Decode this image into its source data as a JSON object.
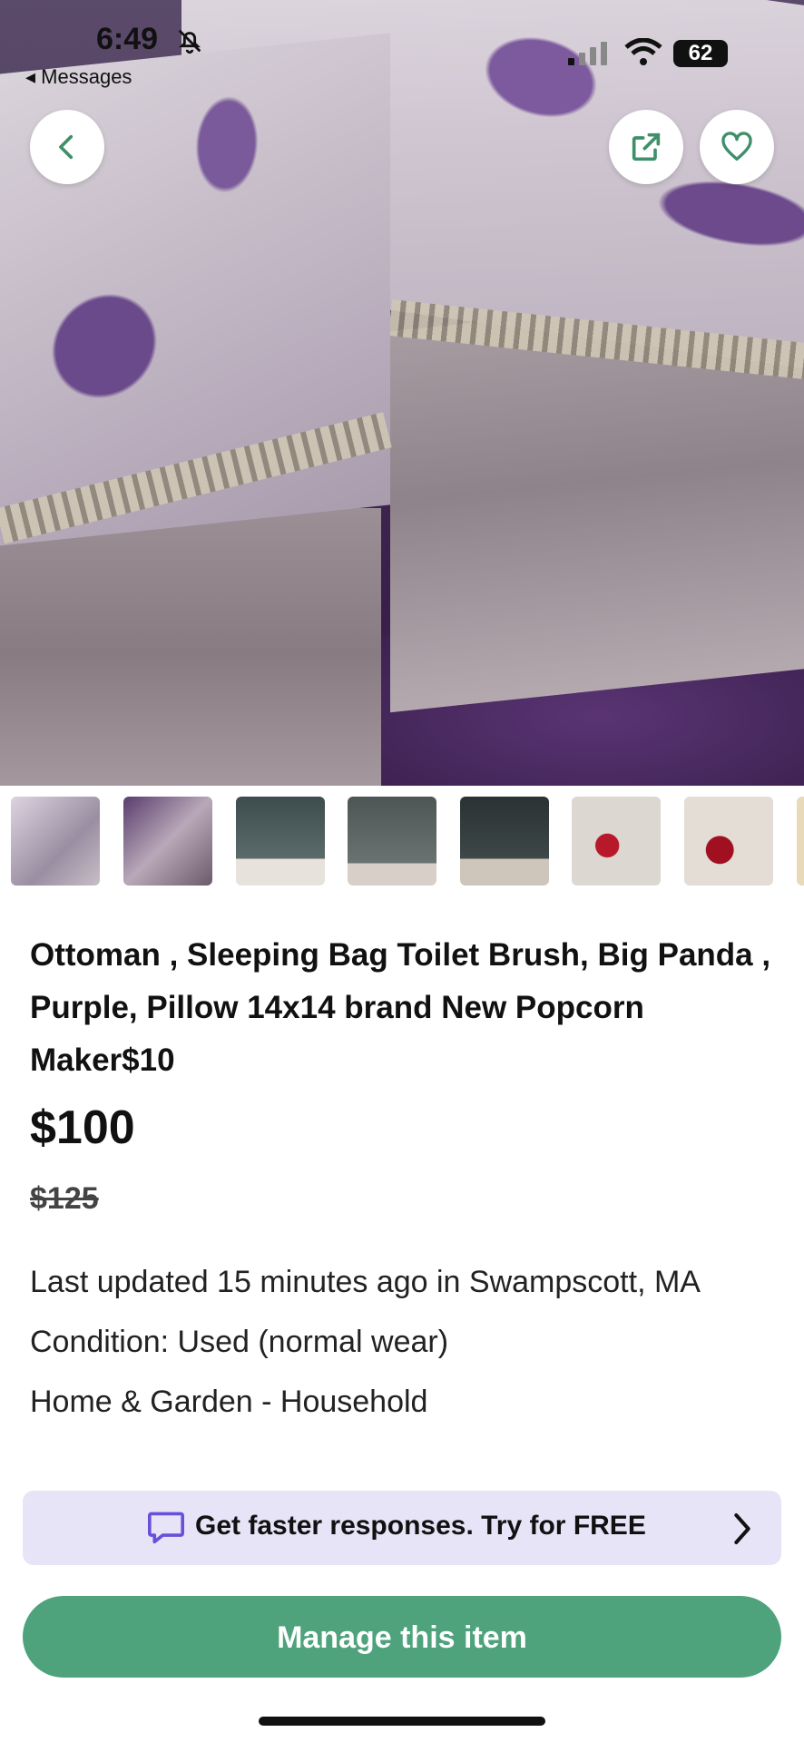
{
  "status_bar": {
    "time": "6:49",
    "back_app": "◂ Messages",
    "battery": "62"
  },
  "listing": {
    "title": "Ottoman , Sleeping Bag Toilet Brush, Big Panda , Purple, Pillow 14x14 brand New Popcorn Maker$10",
    "price": "$100",
    "original_price": "$125",
    "updated": "Last updated 15 minutes ago in Swampscott, MA",
    "condition": "Condition: Used (normal wear)",
    "category": "Home & Garden - Household"
  },
  "thumbnails": [
    "ottoman-1",
    "ottoman-2",
    "sleeping-bag-1",
    "sleeping-bag-2",
    "sleeping-bag-3",
    "toilet-brush-1",
    "toilet-brush-2",
    "item-8"
  ],
  "promo": {
    "text": "Get faster responses.  Try for FREE",
    "icon": "chat-bubble-icon"
  },
  "actions": {
    "manage_label": "Manage this item"
  },
  "colors": {
    "accent_green": "#4ea27c",
    "promo_bg": "#e8e4f8",
    "icon_green": "#3f8f6b",
    "promo_icon": "#6a4fd8"
  }
}
